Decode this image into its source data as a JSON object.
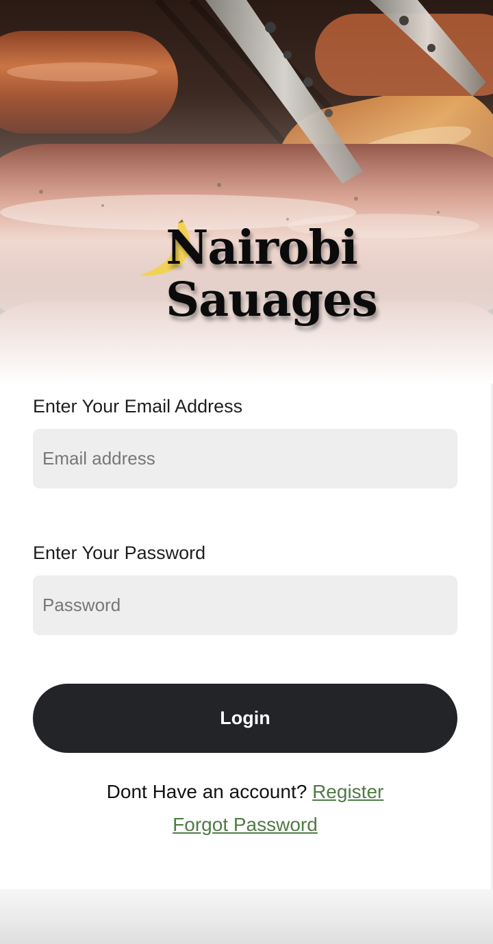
{
  "brand": {
    "line1": "Nairobi",
    "line2": "Sauages",
    "logo_icon": "banana-icon"
  },
  "form": {
    "email_label": "Enter Your Email Address",
    "email_placeholder": "Email address",
    "email_value": "",
    "password_label": "Enter Your Password",
    "password_placeholder": "Password",
    "password_value": "",
    "login_label": "Login"
  },
  "links": {
    "no_account_text": "Dont Have an account?",
    "register_label": "Register",
    "forgot_label": "Forgot Password"
  },
  "colors": {
    "button_bg": "#232428",
    "link": "#4f7a45",
    "input_bg": "#eeeeee",
    "banana": "#f2d14a"
  }
}
